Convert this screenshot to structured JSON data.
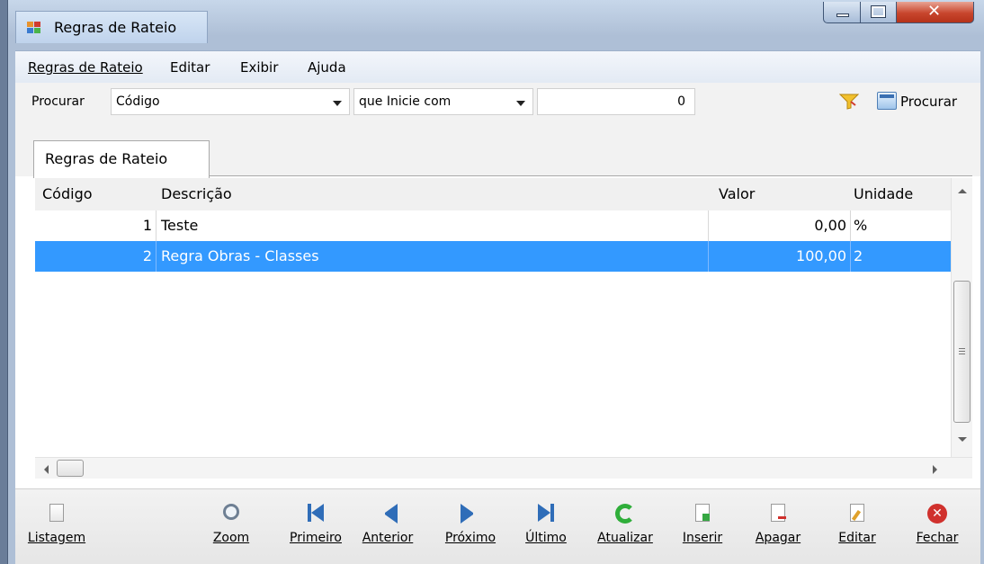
{
  "window": {
    "title": "Regras de Rateio",
    "accent": "#3399ff"
  },
  "menu": {
    "items": [
      {
        "label": "Regras de Rateio"
      },
      {
        "label": "Editar"
      },
      {
        "label": "Exibir"
      },
      {
        "label": "Ajuda"
      }
    ]
  },
  "search": {
    "label": "Procurar",
    "field_value": "Código",
    "condition_value": "que Inicie com",
    "input_value": "0",
    "button_label": "Procurar"
  },
  "tabs": [
    {
      "label": "Regras de Rateio",
      "active": true
    }
  ],
  "table": {
    "columns": [
      "Código",
      "Descrição",
      "Valor",
      "Unidade"
    ],
    "rows": [
      {
        "codigo": "1",
        "descricao": "Teste",
        "valor": "0,00",
        "unidade": "%",
        "selected": false
      },
      {
        "codigo": "2",
        "descricao": "Regra Obras - Classes",
        "valor": "100,00",
        "unidade": "2",
        "selected": true
      }
    ]
  },
  "toolbar": {
    "listagem": "Listagem",
    "zoom": "Zoom",
    "primeiro": "Primeiro",
    "anterior": "Anterior",
    "proximo": "Próximo",
    "ultimo": "Último",
    "atualizar": "Atualizar",
    "inserir": "Inserir",
    "apagar": "Apagar",
    "editar": "Editar",
    "fechar": "Fechar"
  },
  "icons": {
    "app": "app-icon",
    "filter": "funnel-icon",
    "search": "search-icon",
    "listagem": "document-icon",
    "zoom": "magnifier-icon",
    "primeiro": "first-icon",
    "anterior": "previous-icon",
    "proximo": "next-icon",
    "ultimo": "last-icon",
    "atualizar": "refresh-icon",
    "inserir": "insert-icon",
    "apagar": "delete-icon",
    "editar": "edit-icon",
    "fechar": "close-icon"
  }
}
